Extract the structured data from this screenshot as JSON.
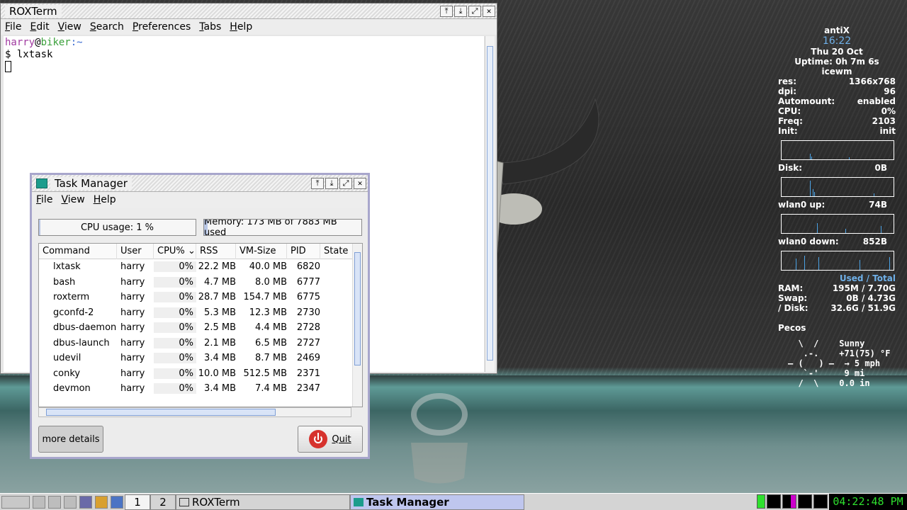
{
  "roxterm": {
    "title": "ROXTerm",
    "menu": [
      "File",
      "Edit",
      "View",
      "Search",
      "Preferences",
      "Tabs",
      "Help"
    ],
    "prompt_user": "harry",
    "prompt_at": "@",
    "prompt_host": "biker",
    "prompt_dir": ":~",
    "command_line": "$ lxtask"
  },
  "taskmgr": {
    "title": "Task Manager",
    "menu": [
      "File",
      "View",
      "Help"
    ],
    "cpu_label": "CPU usage: 1 %",
    "cpu_fraction": 0.01,
    "mem_label": "Memory: 173 MB of 7883 MB used",
    "mem_fraction": 0.022,
    "columns": [
      "Command",
      "User",
      "CPU%",
      "RSS",
      "VM-Size",
      "PID",
      "State"
    ],
    "rows": [
      {
        "cmd": "lxtask",
        "user": "harry",
        "cpu": "0%",
        "rss": "22.2 MB",
        "vm": "40.0 MB",
        "pid": "6820"
      },
      {
        "cmd": "bash",
        "user": "harry",
        "cpu": "0%",
        "rss": "4.7 MB",
        "vm": "8.0 MB",
        "pid": "6777"
      },
      {
        "cmd": "roxterm",
        "user": "harry",
        "cpu": "0%",
        "rss": "28.7 MB",
        "vm": "154.7 MB",
        "pid": "6775"
      },
      {
        "cmd": "gconfd-2",
        "user": "harry",
        "cpu": "0%",
        "rss": "5.3 MB",
        "vm": "12.3 MB",
        "pid": "2730"
      },
      {
        "cmd": "dbus-daemon",
        "user": "harry",
        "cpu": "0%",
        "rss": "2.5 MB",
        "vm": "4.4 MB",
        "pid": "2728"
      },
      {
        "cmd": "dbus-launch",
        "user": "harry",
        "cpu": "0%",
        "rss": "2.1 MB",
        "vm": "6.5 MB",
        "pid": "2727"
      },
      {
        "cmd": "udevil",
        "user": "harry",
        "cpu": "0%",
        "rss": "3.4 MB",
        "vm": "8.7 MB",
        "pid": "2469"
      },
      {
        "cmd": "conky",
        "user": "harry",
        "cpu": "0%",
        "rss": "10.0 MB",
        "vm": "512.5 MB",
        "pid": "2371"
      },
      {
        "cmd": "devmon",
        "user": "harry",
        "cpu": "0%",
        "rss": "3.4 MB",
        "vm": "7.4 MB",
        "pid": "2347"
      }
    ],
    "more_details_label": "more details",
    "quit_label": "Quit"
  },
  "conky": {
    "distro": "antiX",
    "time": "16:22",
    "date": "Thu 20 Oct",
    "uptime": "Uptime: 0h 7m 6s",
    "wm": "icewm",
    "stats": [
      {
        "k": "res:",
        "v": "1366x768"
      },
      {
        "k": "dpi:",
        "v": "96"
      },
      {
        "k": "Automount:",
        "v": "enabled"
      },
      {
        "k": "CPU:",
        "v": "0%"
      },
      {
        "k": "Freq:",
        "v": "2103"
      },
      {
        "k": "Init:",
        "v": "init"
      }
    ],
    "disk_label": "Disk:",
    "disk_value": "0B",
    "up_label": "wlan0 up:",
    "up_value": "74B",
    "down_label": "wlan0 down:",
    "down_value": "852B",
    "used_total": "Used / Total",
    "usage": [
      {
        "k": "RAM:",
        "v": "195M  / 7.70G"
      },
      {
        "k": "Swap:",
        "v": "0B   / 4.73G"
      },
      {
        "k": "/ Disk:",
        "v": "32.6G / 51.9G"
      }
    ],
    "location": "Pecos",
    "weather_lines": [
      "  \\  /    Sunny",
      "   .-.    +71(75) °F",
      "— (   ) —  → 5 mph",
      "   `-'     9 mi",
      "  /  \\    0.0 in"
    ]
  },
  "taskbar": {
    "workspace_1": "1",
    "workspace_2": "2",
    "task_roxterm": "ROXTerm",
    "task_taskmgr": "Task Manager",
    "clock": "04:22:48 PM"
  }
}
